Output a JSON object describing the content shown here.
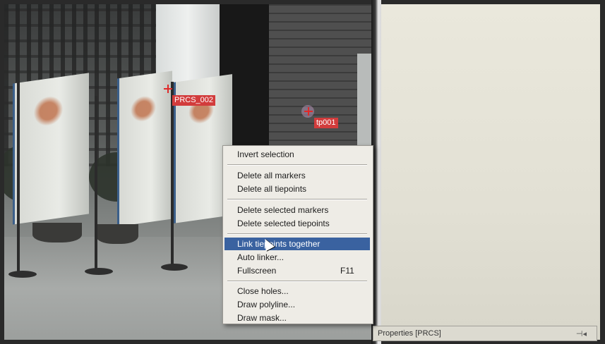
{
  "markers": [
    {
      "label": "PRCS_002"
    },
    {
      "label": "tp001"
    }
  ],
  "context_menu": {
    "items": [
      {
        "label": "Invert selection",
        "shortcut": ""
      },
      {
        "label": "Delete all markers",
        "shortcut": ""
      },
      {
        "label": "Delete all tiepoints",
        "shortcut": ""
      },
      {
        "label": "Delete selected markers",
        "shortcut": ""
      },
      {
        "label": "Delete selected tiepoints",
        "shortcut": ""
      },
      {
        "label": "Link tiepoints together",
        "shortcut": "",
        "highlighted": true
      },
      {
        "label": "Auto linker...",
        "shortcut": ""
      },
      {
        "label": "Fullscreen",
        "shortcut": "F11"
      },
      {
        "label": "Close holes...",
        "shortcut": ""
      },
      {
        "label": "Draw polyline...",
        "shortcut": ""
      },
      {
        "label": "Draw mask...",
        "shortcut": ""
      }
    ]
  },
  "properties_panel": {
    "title": "Properties [PRCS]"
  },
  "colors": {
    "menu_highlight": "#3a62a0",
    "marker_red": "#d23c3c",
    "panel_bg": "#e2e0d4"
  },
  "icons": [
    "pin-icon",
    "cursor-icon",
    "marker-cross-icon"
  ]
}
